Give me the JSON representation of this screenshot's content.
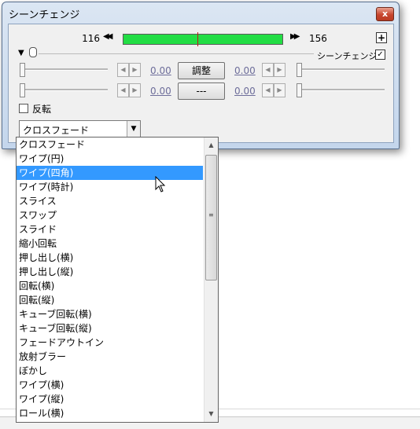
{
  "window": {
    "title": "シーンチェンジ",
    "close_label": "x"
  },
  "frame": {
    "start": "116",
    "end": "156",
    "prev_icon": "◀◀",
    "next_icon": "▶▶",
    "plus": "+"
  },
  "effect": {
    "label": "シーンチェンジ",
    "checked_mark": "✓"
  },
  "rows": [
    {
      "left_value": "0.00",
      "button": "調整",
      "right_value": "0.00"
    },
    {
      "left_value": "0.00",
      "button": "---",
      "right_value": "0.00"
    }
  ],
  "reverse": {
    "label": "反転"
  },
  "combo": {
    "selected": "クロスフェード",
    "arrow": "▼"
  },
  "dropdown": {
    "items": [
      "クロスフェード",
      "ワイプ(円)",
      "ワイプ(四角)",
      "ワイプ(時計)",
      "スライス",
      "スワップ",
      "スライド",
      "縮小回転",
      "押し出し(横)",
      "押し出し(縦)",
      "回転(横)",
      "回転(縦)",
      "キューブ回転(横)",
      "キューブ回転(縦)",
      "フェードアウトイン",
      "放射ブラー",
      "ぼかし",
      "ワイプ(横)",
      "ワイプ(縦)",
      "ロール(横)"
    ],
    "selected_index": 2,
    "scroll_up": "▲",
    "scroll_down": "▼"
  }
}
